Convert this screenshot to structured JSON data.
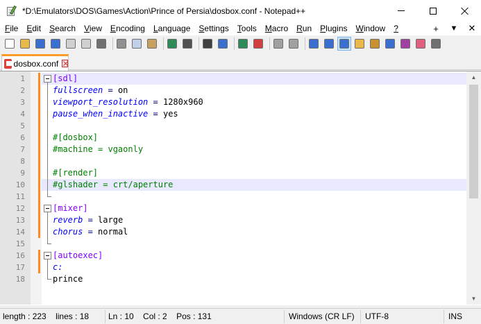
{
  "window": {
    "title": "*D:\\Emulators\\DOS\\Games\\Action\\Prince of Persia\\dosbox.conf - Notepad++"
  },
  "menu": {
    "items": [
      {
        "label": "File",
        "u": "F",
        "rest": "ile"
      },
      {
        "label": "Edit",
        "u": "E",
        "rest": "dit"
      },
      {
        "label": "Search",
        "u": "S",
        "rest": "earch"
      },
      {
        "label": "View",
        "u": "V",
        "rest": "iew"
      },
      {
        "label": "Encoding",
        "u": "E",
        "rest": "ncoding"
      },
      {
        "label": "Language",
        "u": "L",
        "rest": "anguage"
      },
      {
        "label": "Settings",
        "u": "S",
        "rest": "ettings"
      },
      {
        "label": "Tools",
        "u": "T",
        "rest": "ools"
      },
      {
        "label": "Macro",
        "u": "M",
        "rest": "acro"
      },
      {
        "label": "Run",
        "u": "R",
        "rest": "un"
      },
      {
        "label": "Plugins",
        "u": "P",
        "rest": "lugins"
      },
      {
        "label": "Window",
        "u": "W",
        "rest": "indow"
      },
      {
        "label": "?",
        "u": "?",
        "rest": ""
      }
    ],
    "right": [
      "+",
      "▼",
      "✕"
    ]
  },
  "toolbar": {
    "icons": [
      "new-file-icon",
      "open-file-icon",
      "save-icon",
      "save-all-icon",
      "close-icon",
      "close-all-icon",
      "print-icon",
      "cut-icon",
      "copy-icon",
      "paste-icon",
      "undo-icon",
      "redo-icon",
      "find-icon",
      "replace-icon",
      "zoom-in-icon",
      "zoom-out-icon",
      "sync-vertical-icon",
      "sync-horizontal-icon",
      "word-wrap-icon",
      "show-all-chars-icon",
      "indent-guide-icon",
      "udl-icon",
      "doc-map-icon",
      "doc-list-icon",
      "function-list-icon",
      "folder-as-workspace-icon",
      "monitoring-icon"
    ]
  },
  "tab": {
    "label": "dosbox.conf",
    "color": "#fa9b28"
  },
  "editor": {
    "lines": [
      {
        "n": "1",
        "t": "section",
        "text": "[sdl]"
      },
      {
        "n": "2",
        "t": "kv",
        "key": "fullscreen",
        "val": "on"
      },
      {
        "n": "3",
        "t": "kv",
        "key": "viewport_resolution",
        "val": "1280x960"
      },
      {
        "n": "4",
        "t": "kv",
        "key": "pause_when_inactive",
        "val": "yes"
      },
      {
        "n": "5",
        "t": "blank",
        "text": ""
      },
      {
        "n": "6",
        "t": "comment",
        "text": "#[dosbox]"
      },
      {
        "n": "7",
        "t": "comment",
        "text": "#machine = vgaonly"
      },
      {
        "n": "8",
        "t": "blank",
        "text": ""
      },
      {
        "n": "9",
        "t": "comment",
        "text": "#[render]"
      },
      {
        "n": "10",
        "t": "comment",
        "text": "#glshader = crt/aperture"
      },
      {
        "n": "11",
        "t": "blank",
        "text": ""
      },
      {
        "n": "12",
        "t": "section",
        "text": "[mixer]"
      },
      {
        "n": "13",
        "t": "kv",
        "key": "reverb",
        "val": "large"
      },
      {
        "n": "14",
        "t": "kv",
        "key": "chorus",
        "val": "normal"
      },
      {
        "n": "15",
        "t": "blank",
        "text": ""
      },
      {
        "n": "16",
        "t": "section",
        "text": "[autoexec]"
      },
      {
        "n": "17",
        "t": "key",
        "text": "c:"
      },
      {
        "n": "18",
        "t": "plain",
        "text": "prince"
      }
    ],
    "operator": " = "
  },
  "status": {
    "length": "length : 223",
    "lines": "lines : 18",
    "ln": "Ln : 10",
    "col": "Col : 2",
    "pos": "Pos : 131",
    "eol": "Windows (CR LF)",
    "encoding": "UTF-8",
    "mode": "INS"
  }
}
